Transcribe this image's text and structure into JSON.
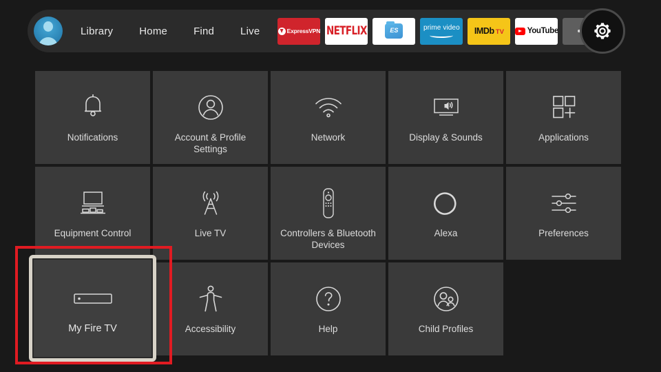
{
  "screen": {
    "device": "Fire TV",
    "page_title": "Settings",
    "background_color": "#191919",
    "tile_color": "#3a3a3a",
    "focus_border_color": "#d8d3c8",
    "annotation_color": "#e01b22"
  },
  "navbar": {
    "avatar": {
      "icon": "profile-avatar-icon",
      "color": "#2d87b8"
    },
    "links": [
      {
        "label": "Library"
      },
      {
        "label": "Home"
      },
      {
        "label": "Find"
      },
      {
        "label": "Live"
      }
    ],
    "apps": [
      {
        "name": "ExpressVPN",
        "label": "ExpressVPN",
        "bg": "#d0242c"
      },
      {
        "name": "Netflix",
        "label": "NETFLIX",
        "bg": "#ffffff"
      },
      {
        "name": "ES File Explorer",
        "label": "ES",
        "bg": "#ffffff"
      },
      {
        "name": "Prime Video",
        "label": "prime video",
        "bg": "#1b8fc4"
      },
      {
        "name": "IMDb TV",
        "label": "IMDb",
        "label2": "TV",
        "bg": "#f5c518"
      },
      {
        "name": "YouTube",
        "label": "YouTube",
        "bg": "#ffffff"
      },
      {
        "name": "More",
        "label": "",
        "bg": "#5e5e5e"
      }
    ],
    "settings_button": {
      "icon": "gear-icon",
      "label": "Settings"
    }
  },
  "grid": {
    "rows": [
      [
        {
          "icon": "bell-icon",
          "label": "Notifications",
          "focused": false
        },
        {
          "icon": "person-circle-icon",
          "label": "Account & Profile Settings",
          "focused": false
        },
        {
          "icon": "wifi-icon",
          "label": "Network",
          "focused": false
        },
        {
          "icon": "tv-speaker-icon",
          "label": "Display & Sounds",
          "focused": false
        },
        {
          "icon": "app-squares-plus-icon",
          "label": "Applications",
          "focused": false
        }
      ],
      [
        {
          "icon": "monitor-equipment-icon",
          "label": "Equipment Control",
          "focused": false
        },
        {
          "icon": "antenna-tower-icon",
          "label": "Live TV",
          "focused": false
        },
        {
          "icon": "remote-control-icon",
          "label": "Controllers & Bluetooth Devices",
          "focused": false
        },
        {
          "icon": "alexa-ring-icon",
          "label": "Alexa",
          "focused": false
        },
        {
          "icon": "sliders-icon",
          "label": "Preferences",
          "focused": false
        }
      ],
      [
        {
          "icon": "fire-tv-stick-icon",
          "label": "My Fire TV",
          "focused": true
        },
        {
          "icon": "accessibility-person-icon",
          "label": "Accessibility",
          "focused": false
        },
        {
          "icon": "question-circle-icon",
          "label": "Help",
          "focused": false
        },
        {
          "icon": "child-profiles-icon",
          "label": "Child Profiles",
          "focused": false
        },
        {
          "icon": "",
          "label": "",
          "focused": false,
          "empty": true
        }
      ]
    ]
  }
}
